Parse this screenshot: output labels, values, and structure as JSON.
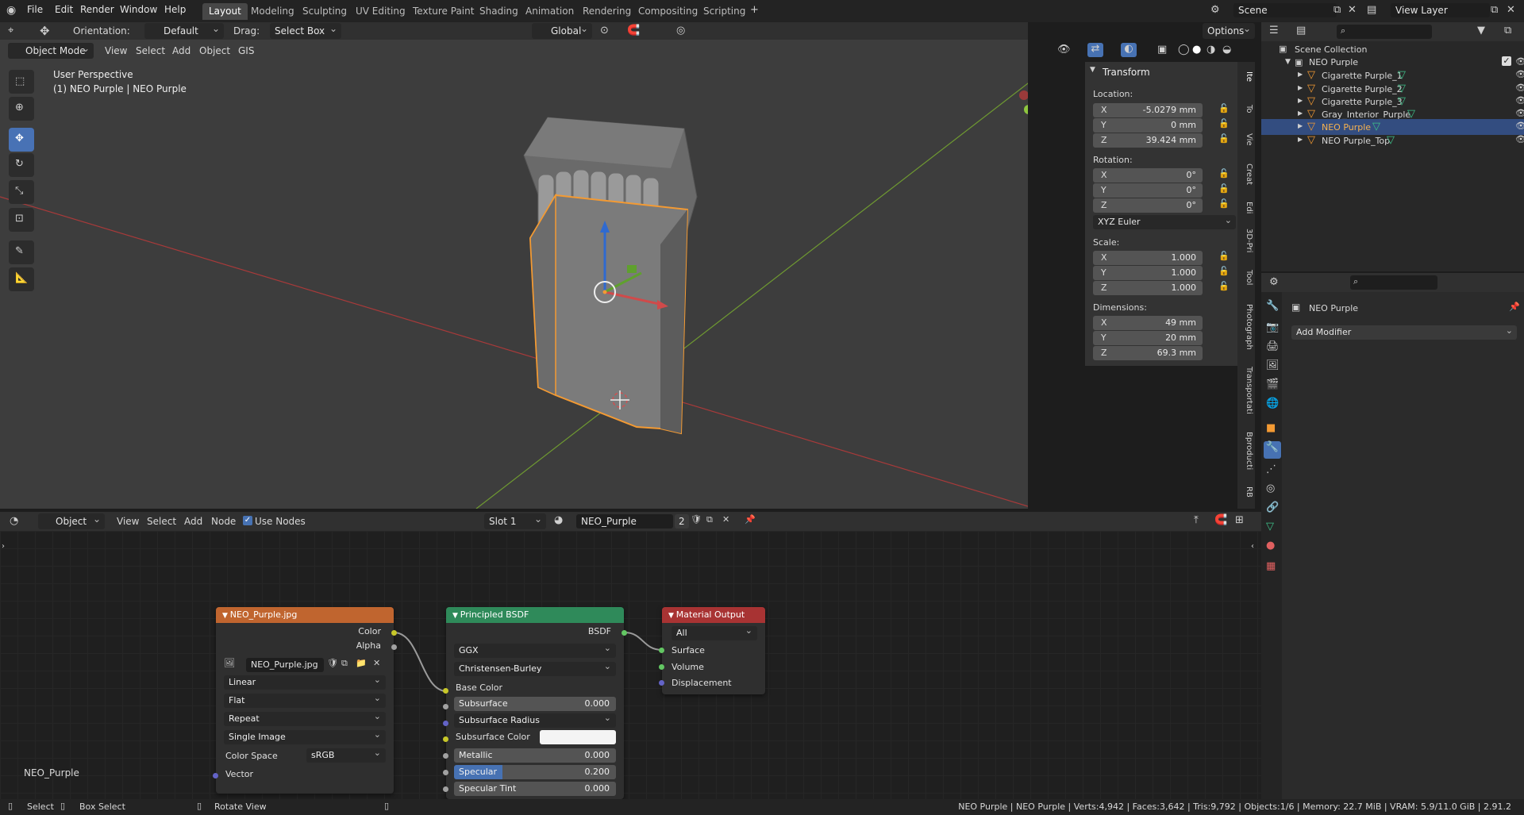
{
  "topbar": {
    "menus": [
      "File",
      "Edit",
      "Render",
      "Window",
      "Help"
    ],
    "workspaces": [
      "Layout",
      "Modeling",
      "Sculpting",
      "UV Editing",
      "Texture Paint",
      "Shading",
      "Animation",
      "Rendering",
      "Compositing",
      "Scripting"
    ],
    "active_workspace": "Layout",
    "scene": "Scene",
    "view_layer": "View Layer"
  },
  "tool_header": {
    "orientation_label": "Orientation:",
    "orientation": "Default",
    "drag_label": "Drag:",
    "drag": "Select Box",
    "transform_orientation": "Global",
    "options": "Options"
  },
  "viewport_header": {
    "mode": "Object Mode",
    "menus": [
      "View",
      "Select",
      "Add",
      "Object",
      "GIS"
    ]
  },
  "viewport": {
    "perspective": "User Perspective",
    "object_info": "(1) NEO Purple | NEO Purple"
  },
  "transform_panel": {
    "title": "Transform",
    "location_label": "Location:",
    "location": [
      {
        "axis": "X",
        "value": "-5.0279 mm"
      },
      {
        "axis": "Y",
        "value": "0 mm"
      },
      {
        "axis": "Z",
        "value": "39.424 mm"
      }
    ],
    "rotation_label": "Rotation:",
    "rotation": [
      {
        "axis": "X",
        "value": "0°"
      },
      {
        "axis": "Y",
        "value": "0°"
      },
      {
        "axis": "Z",
        "value": "0°"
      }
    ],
    "rotation_mode": "XYZ Euler",
    "scale_label": "Scale:",
    "scale": [
      {
        "axis": "X",
        "value": "1.000"
      },
      {
        "axis": "Y",
        "value": "1.000"
      },
      {
        "axis": "Z",
        "value": "1.000"
      }
    ],
    "dimensions_label": "Dimensions:",
    "dimensions": [
      {
        "axis": "X",
        "value": "49 mm"
      },
      {
        "axis": "Y",
        "value": "20 mm"
      },
      {
        "axis": "Z",
        "value": "69.3 mm"
      }
    ]
  },
  "side_tabs": [
    "Ite",
    "To",
    "Vie",
    "Creat",
    "Edi",
    "3D-Pri",
    "Tool",
    "Photograph",
    "Transportati",
    "Bproducti",
    "RB"
  ],
  "outliner": {
    "root": "Scene Collection",
    "collection": "NEO Purple",
    "items": [
      "Cigarette Purple_1",
      "Cigarette Purple_2",
      "Cigarette Purple_3",
      "Gray_Interior_Purple",
      "NEO Purple",
      "NEO Purple_Top"
    ],
    "selected": "NEO Purple"
  },
  "properties": {
    "object_name": "NEO Purple",
    "add_modifier": "Add Modifier"
  },
  "node_header": {
    "editor_type": "Object",
    "menus": [
      "View",
      "Select",
      "Add",
      "Node"
    ],
    "use_nodes": "Use Nodes",
    "slot": "Slot 1",
    "material": "NEO_Purple",
    "users": "2"
  },
  "node_editor": {
    "material_label": "NEO_Purple",
    "image_node": {
      "title": "NEO_Purple.jpg",
      "outputs": [
        "Color",
        "Alpha"
      ],
      "image": "NEO_Purple.jpg",
      "interpolation": "Linear",
      "projection": "Flat",
      "extension": "Repeat",
      "source": "Single Image",
      "color_space_label": "Color Space",
      "color_space": "sRGB",
      "vector": "Vector"
    },
    "bsdf_node": {
      "title": "Principled BSDF",
      "output": "BSDF",
      "distribution": "GGX",
      "subsurface_method": "Christensen-Burley",
      "base_color": "Base Color",
      "subsurface": {
        "label": "Subsurface",
        "value": "0.000"
      },
      "subsurface_radius": "Subsurface Radius",
      "subsurface_color": "Subsurface Color",
      "metallic": {
        "label": "Metallic",
        "value": "0.000"
      },
      "specular": {
        "label": "Specular",
        "value": "0.200"
      },
      "specular_tint": {
        "label": "Specular Tint",
        "value": "0.000"
      }
    },
    "output_node": {
      "title": "Material Output",
      "target": "All",
      "inputs": [
        "Surface",
        "Volume",
        "Displacement"
      ]
    }
  },
  "status_bar": {
    "select": "Select",
    "box_select": "Box Select",
    "rotate_view": "Rotate View",
    "stats": "NEO Purple | NEO Purple | Verts:4,942 | Faces:3,642 | Tris:9,792 | Objects:1/6 | Memory: 22.7 MiB | VRAM: 5.9/11.0 GiB | 2.91.2"
  },
  "colors": {
    "accent": "#4772b3",
    "image_node_header": "#c0652f",
    "shader_node_header": "#2f8a5a",
    "output_node_header": "#a83333",
    "selection_outline": "#f39a33"
  }
}
